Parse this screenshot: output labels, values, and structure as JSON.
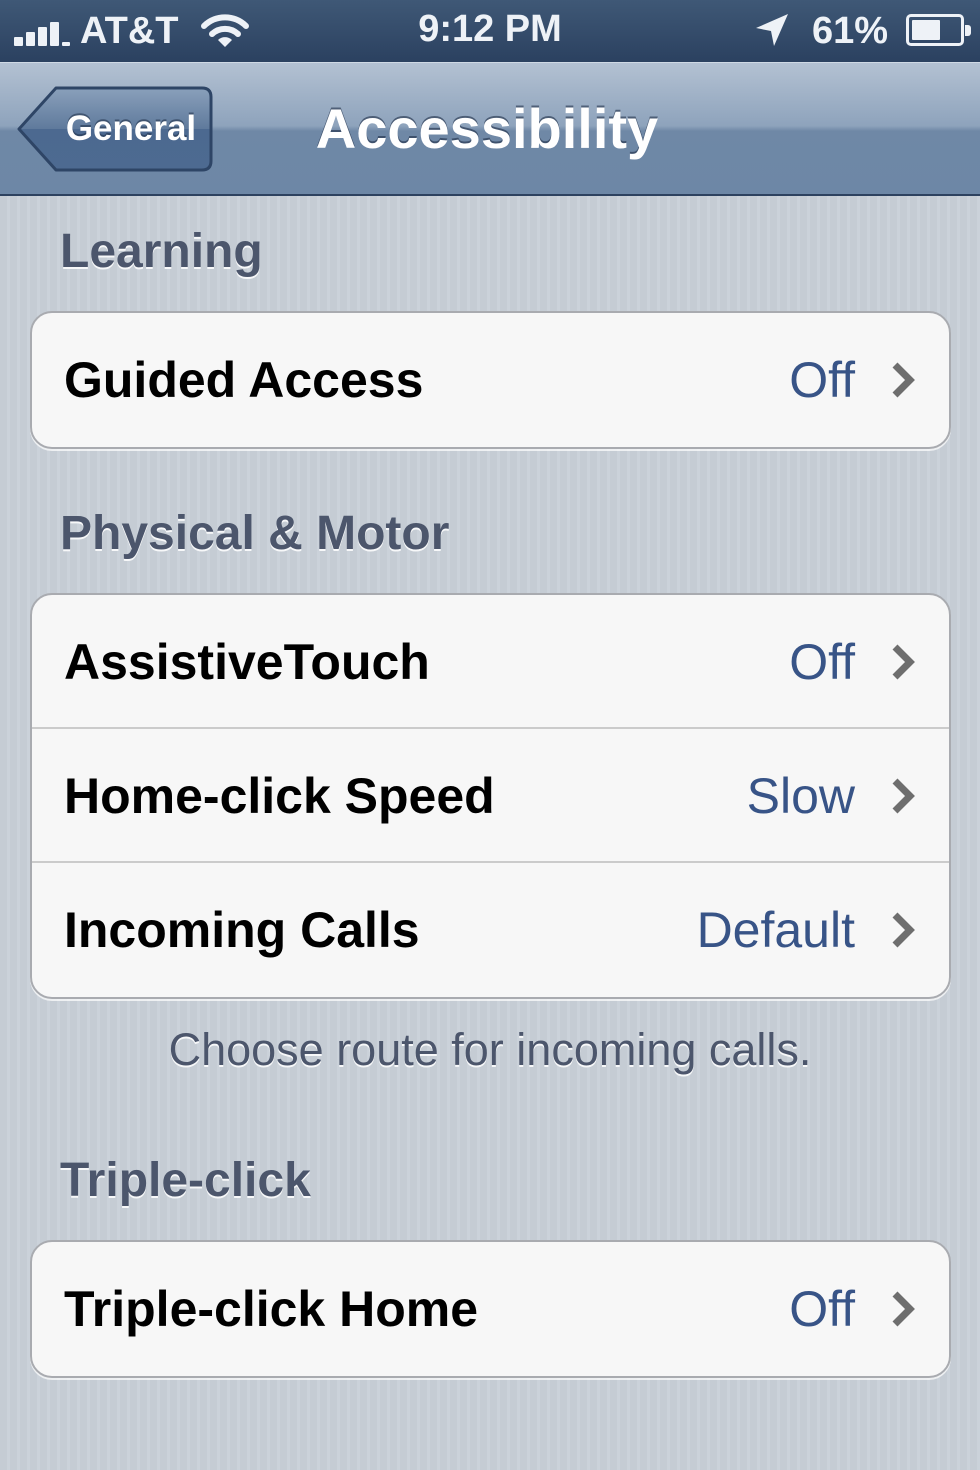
{
  "status_bar": {
    "carrier": "AT&T",
    "time": "9:12 PM",
    "battery_percent": "61%",
    "battery_level": 0.61,
    "signal_icon": "signal-bars-icon",
    "wifi_icon": "wifi-icon",
    "location_icon": "location-arrow-icon",
    "battery_icon": "battery-icon"
  },
  "nav": {
    "back_label": "General",
    "title": "Accessibility"
  },
  "sections": [
    {
      "header": "Learning",
      "rows": [
        {
          "label": "Guided Access",
          "value": "Off"
        }
      ]
    },
    {
      "header": "Physical & Motor",
      "rows": [
        {
          "label": "AssistiveTouch",
          "value": "Off"
        },
        {
          "label": "Home-click Speed",
          "value": "Slow"
        },
        {
          "label": "Incoming Calls",
          "value": "Default"
        }
      ],
      "footer": "Choose route for incoming calls."
    },
    {
      "header": "Triple-click",
      "rows": [
        {
          "label": "Triple-click Home",
          "value": "Off"
        }
      ]
    }
  ],
  "colors": {
    "nav_bar": "#6d87a6",
    "status_bar": "#2b4160",
    "value_text": "#385487",
    "section_header": "#4c566c",
    "background": "#c5ccd4"
  }
}
